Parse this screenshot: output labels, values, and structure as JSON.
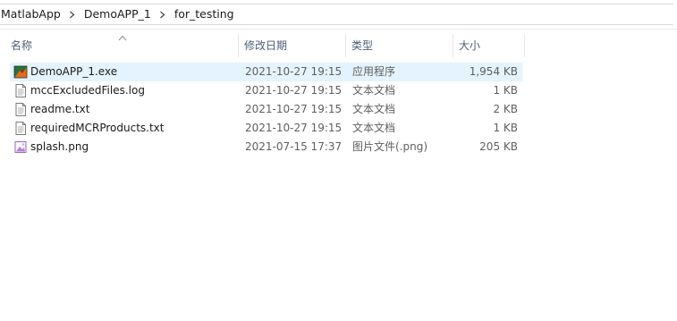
{
  "breadcrumb": {
    "items": [
      "MatlabApp",
      "DemoAPP_1",
      "for_testing"
    ]
  },
  "columns": {
    "name": "名称",
    "date": "修改日期",
    "type": "类型",
    "size": "大小"
  },
  "files": [
    {
      "name": "DemoAPP_1.exe",
      "date": "2021-10-27 19:15",
      "type": "应用程序",
      "size": "1,954 KB",
      "icon": "matlab-app-icon",
      "selected": true
    },
    {
      "name": "mccExcludedFiles.log",
      "date": "2021-10-27 19:15",
      "type": "文本文档",
      "size": "1 KB",
      "icon": "text-document-icon",
      "selected": false
    },
    {
      "name": "readme.txt",
      "date": "2021-10-27 19:15",
      "type": "文本文档",
      "size": "2 KB",
      "icon": "text-document-icon",
      "selected": false
    },
    {
      "name": "requiredMCRProducts.txt",
      "date": "2021-10-27 19:15",
      "type": "文本文档",
      "size": "1 KB",
      "icon": "text-document-icon",
      "selected": false
    },
    {
      "name": "splash.png",
      "date": "2021-07-15 17:37",
      "type": "图片文件(.png)",
      "size": "205 KB",
      "icon": "image-file-icon",
      "selected": false
    }
  ],
  "colors": {
    "selection": "#e5f3ff",
    "header_text": "#4c607a",
    "secondary_text": "#5f5f5f"
  }
}
